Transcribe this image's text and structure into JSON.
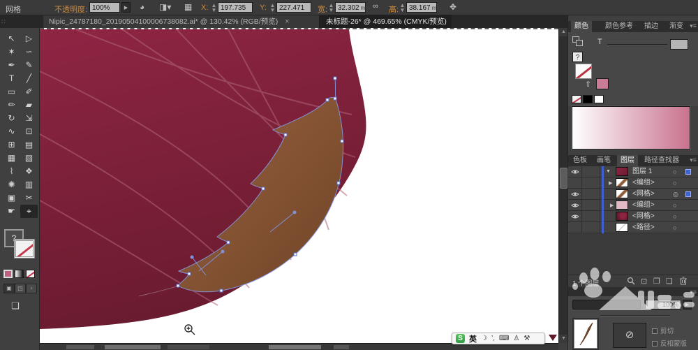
{
  "control_bar": {
    "context_label": "网格",
    "opacity_label": "不透明度:",
    "opacity_value": "100%",
    "fields": {
      "x": {
        "label": "X:",
        "value": "197.735"
      },
      "y": {
        "label": "Y:",
        "value": "227.471"
      },
      "w": {
        "label": "宽:",
        "value": "32.302",
        "unit": "mm"
      },
      "h": {
        "label": "高:",
        "value": "38.167",
        "unit": "mm"
      }
    },
    "icons": {
      "recolor": "◕",
      "align_dd": "◨▾",
      "grid": "▦",
      "link": "∞",
      "transform": "✥"
    }
  },
  "tab_bar": {
    "close_glyph": "×",
    "tabs": [
      {
        "label": "Nipic_24787180_20190504100006738082.ai* @ 130.42% (RGB/预览)",
        "active": false
      },
      {
        "label": "未标题-26* @ 469.65% (CMYK/预览)",
        "active": true
      }
    ]
  },
  "toolbar": {
    "fill_help_glyph": "?",
    "tools": [
      {
        "name": "selection",
        "glyph": "↖"
      },
      {
        "name": "direct-selection",
        "glyph": "▷"
      },
      {
        "name": "magic-wand",
        "glyph": "✶"
      },
      {
        "name": "lasso",
        "glyph": "∽"
      },
      {
        "name": "pen",
        "glyph": "✒"
      },
      {
        "name": "curvature",
        "glyph": "✎"
      },
      {
        "name": "type",
        "glyph": "T"
      },
      {
        "name": "line-segment",
        "glyph": "╱"
      },
      {
        "name": "rectangle",
        "glyph": "▭"
      },
      {
        "name": "paintbrush",
        "glyph": "✐"
      },
      {
        "name": "pencil",
        "glyph": "✏"
      },
      {
        "name": "eraser",
        "glyph": "▰"
      },
      {
        "name": "rotate",
        "glyph": "↻"
      },
      {
        "name": "scale",
        "glyph": "⇲"
      },
      {
        "name": "width",
        "glyph": "∿"
      },
      {
        "name": "free-transform",
        "glyph": "⊡"
      },
      {
        "name": "shape-builder",
        "glyph": "⊞"
      },
      {
        "name": "perspective-grid",
        "glyph": "▤"
      },
      {
        "name": "mesh",
        "glyph": "▦"
      },
      {
        "name": "gradient",
        "glyph": "▧"
      },
      {
        "name": "eyedropper",
        "glyph": "⌇"
      },
      {
        "name": "blend",
        "glyph": "❖"
      },
      {
        "name": "symbol-sprayer",
        "glyph": "✺"
      },
      {
        "name": "column-graph",
        "glyph": "▥"
      },
      {
        "name": "artboard",
        "glyph": "▣"
      },
      {
        "name": "slice",
        "glyph": "✂"
      },
      {
        "name": "hand",
        "glyph": "☛"
      },
      {
        "name": "zoom",
        "glyph": "⌖",
        "active": true
      }
    ]
  },
  "right_dock": {
    "panel_tabs_top": [
      "颜色",
      "颜色参考",
      "描边",
      "渐变"
    ],
    "color_panel": {
      "tint_label": "T"
    },
    "panel_tabs_mid": [
      "色板",
      "画笔",
      "图层",
      "路径查找器"
    ],
    "layers": {
      "rows": [
        {
          "name": "图层 1"
        },
        {
          "name": "<编组>"
        },
        {
          "name": "<网格>"
        },
        {
          "name": "<编组>"
        },
        {
          "name": "<网格>"
        },
        {
          "name": "<路径>"
        }
      ],
      "status": "1 个图层"
    },
    "transparency": {
      "opacity_value": "100%",
      "clip_label": "剪切",
      "invert_mask_label": "反相蒙版"
    }
  },
  "ime": {
    "logo": "S",
    "lang_label": "英"
  },
  "colors": {
    "petal_light": "#8E2543",
    "petal_dark": "#6A1B2F",
    "vein": "#B06578",
    "leaf_brown_light": "#9A6240",
    "leaf_brown_dark": "#6E4426",
    "path_blue": "#8291D7",
    "accent_blue": "#3E63D6",
    "gradient_start": "#FFFFFF",
    "gradient_end": "#C9728E",
    "pink_swatch": "#C97D94"
  }
}
